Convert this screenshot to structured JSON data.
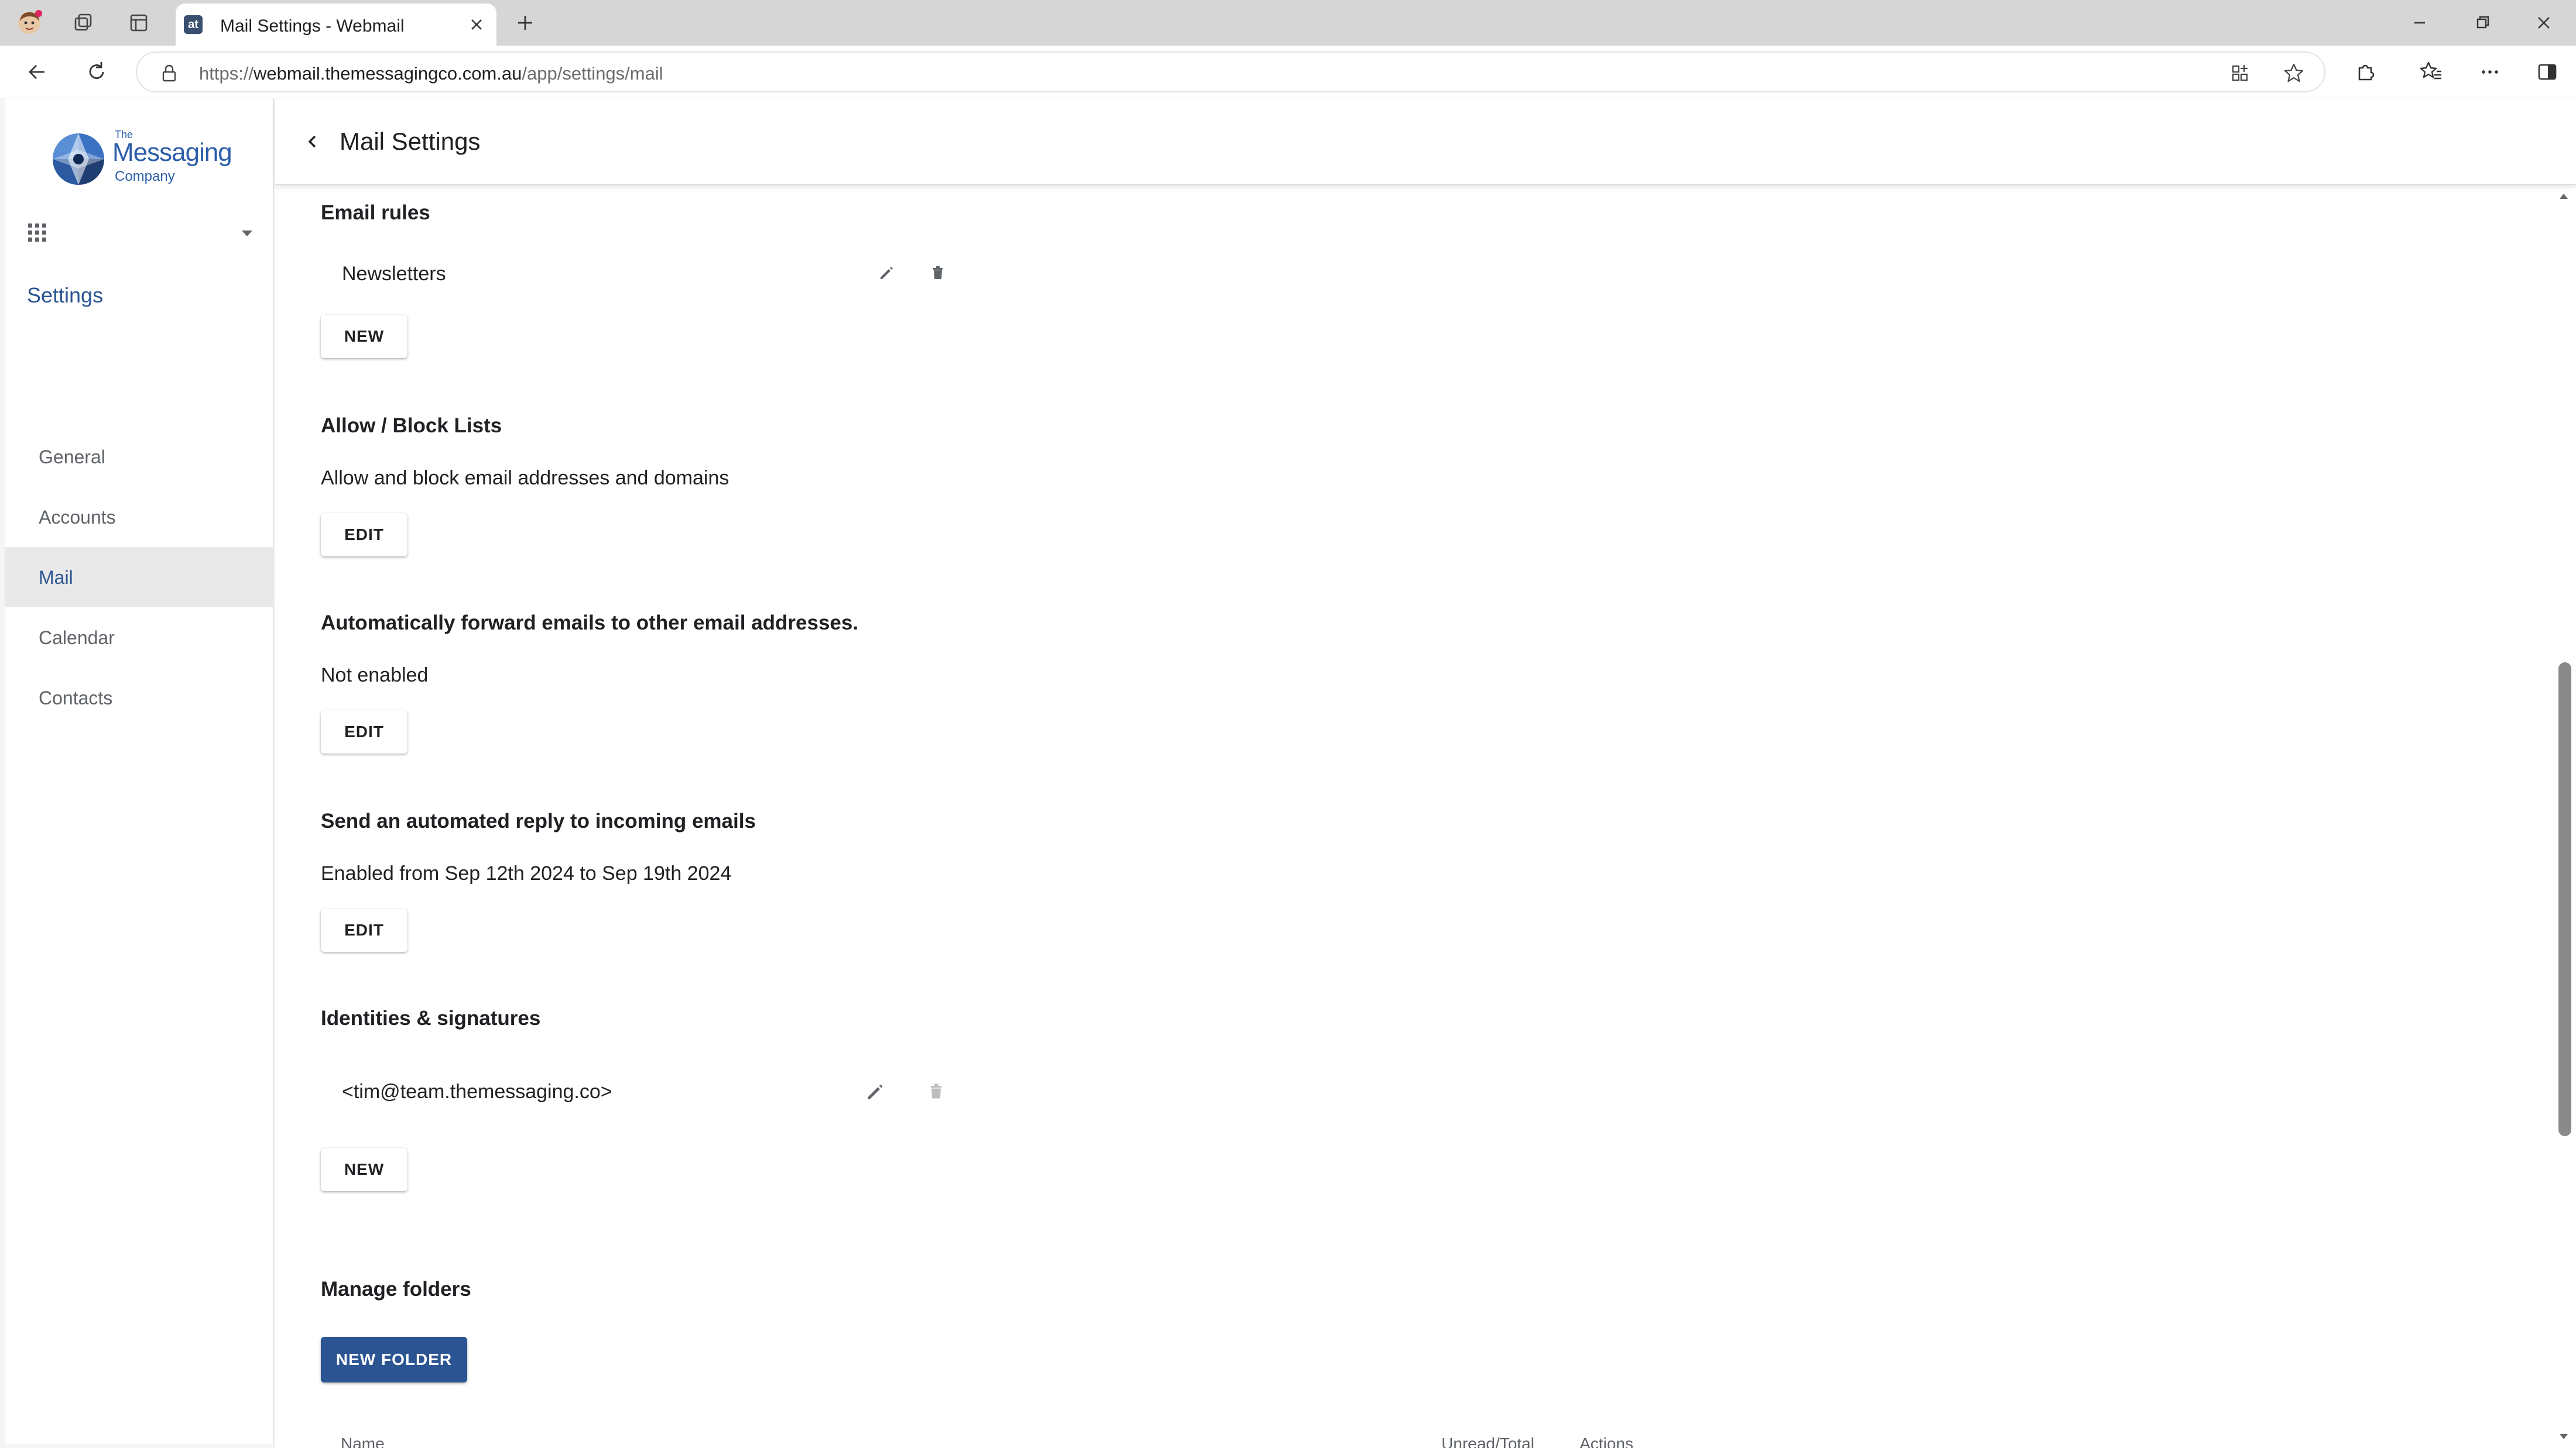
{
  "browser": {
    "tab_title": "Mail Settings - Webmail",
    "tab_favicon_text": "at",
    "url_prefix": "https://",
    "url_host": "webmail.themessagingco.com.au",
    "url_path": "/app/settings/mail"
  },
  "logo": {
    "the": "The",
    "main": "Messaging",
    "sub": "Company"
  },
  "sidebar": {
    "heading": "Settings",
    "items": [
      {
        "label": "General"
      },
      {
        "label": "Accounts"
      },
      {
        "label": "Mail"
      },
      {
        "label": "Calendar"
      },
      {
        "label": "Contacts"
      }
    ]
  },
  "header": {
    "title": "Mail Settings"
  },
  "sections": {
    "email_rules": {
      "title": "Email rules",
      "rule": "Newsletters",
      "button": "NEW"
    },
    "allow_block": {
      "title": "Allow / Block Lists",
      "text": "Allow and block email addresses and domains",
      "button": "EDIT"
    },
    "forward": {
      "title": "Automatically forward emails to other email addresses.",
      "text": "Not enabled",
      "button": "EDIT"
    },
    "auto_reply": {
      "title": "Send an automated reply to incoming emails",
      "text": "Enabled from Sep 12th 2024 to Sep 19th 2024",
      "button": "EDIT"
    },
    "identities": {
      "title": "Identities & signatures",
      "identity": "<tim@team.themessaging.co>",
      "button": "NEW"
    },
    "folders": {
      "title": "Manage folders",
      "button": "NEW FOLDER",
      "col_name": "Name",
      "col_unread": "Unread/Total",
      "col_actions": "Actions"
    }
  }
}
